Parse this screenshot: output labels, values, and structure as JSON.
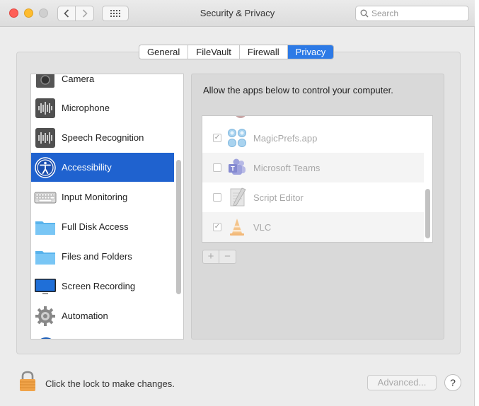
{
  "window": {
    "title": "Security & Privacy",
    "search_placeholder": "Search"
  },
  "tabs": [
    {
      "label": "General",
      "active": false
    },
    {
      "label": "FileVault",
      "active": false
    },
    {
      "label": "Firewall",
      "active": false
    },
    {
      "label": "Privacy",
      "active": true
    }
  ],
  "categories": [
    {
      "label": "Camera",
      "icon": "camera-icon"
    },
    {
      "label": "Microphone",
      "icon": "microphone-icon"
    },
    {
      "label": "Speech Recognition",
      "icon": "speech-recognition-icon"
    },
    {
      "label": "Accessibility",
      "icon": "accessibility-icon",
      "selected": true
    },
    {
      "label": "Input Monitoring",
      "icon": "keyboard-icon"
    },
    {
      "label": "Full Disk Access",
      "icon": "folder-icon"
    },
    {
      "label": "Files and Folders",
      "icon": "folder-icon"
    },
    {
      "label": "Screen Recording",
      "icon": "monitor-icon"
    },
    {
      "label": "Automation",
      "icon": "gear-icon"
    }
  ],
  "content": {
    "description": "Allow the apps below to control your computer.",
    "apps": [
      {
        "name": "MagicPrefs.app",
        "checked": true,
        "icon": "magicprefs-icon"
      },
      {
        "name": "Microsoft Teams",
        "checked": false,
        "icon": "teams-icon"
      },
      {
        "name": "Script Editor",
        "checked": false,
        "icon": "script-editor-icon"
      },
      {
        "name": "VLC",
        "checked": true,
        "icon": "vlc-icon"
      }
    ],
    "add_label": "+",
    "remove_label": "−"
  },
  "footer": {
    "lock_text": "Click the lock to make changes.",
    "advanced_label": "Advanced...",
    "help_label": "?"
  },
  "colors": {
    "accent": "#2d7ae6",
    "selection": "#1f62cf"
  }
}
